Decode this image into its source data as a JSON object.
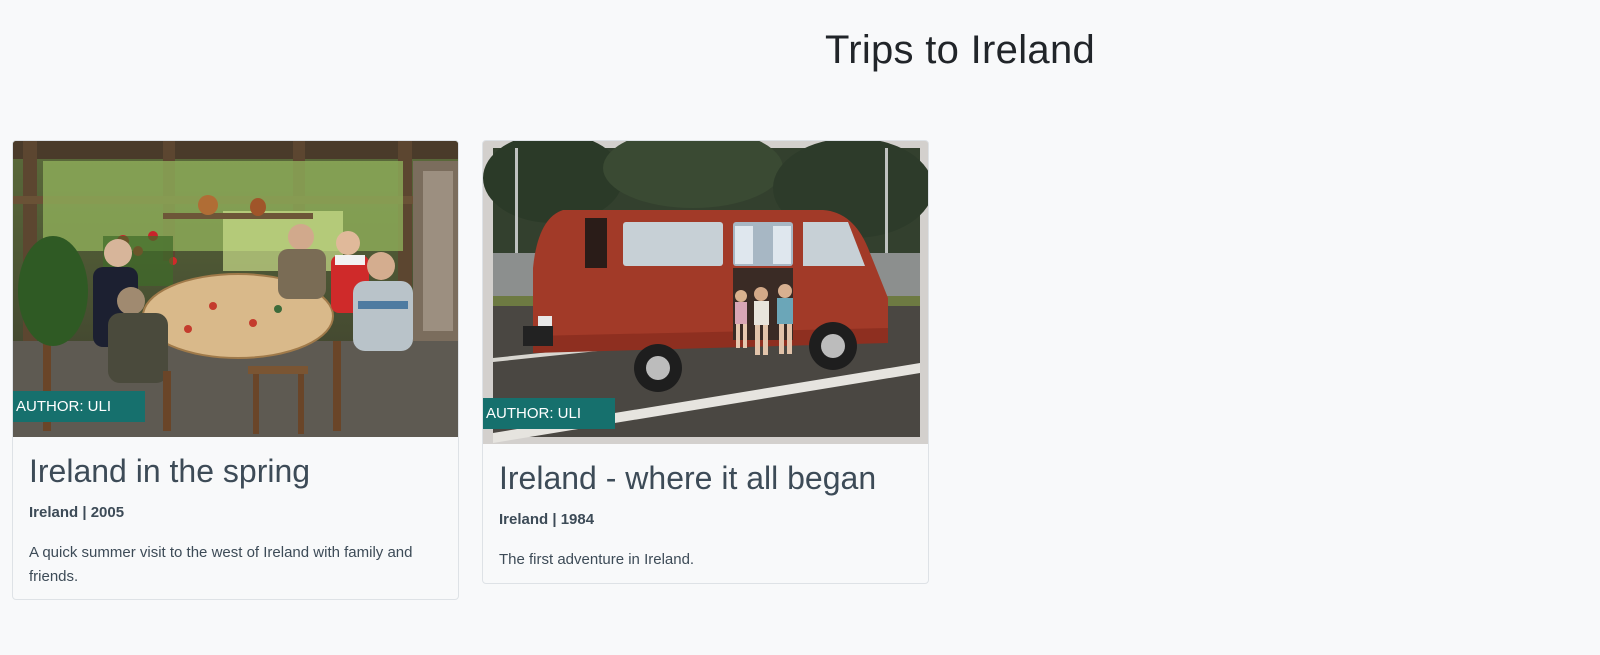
{
  "page": {
    "title": "Trips to Ireland"
  },
  "cards": [
    {
      "author": "AUTHOR: ULI",
      "title": "Ireland in the spring",
      "meta": "Ireland | 2005",
      "description": "A quick summer visit to the west of Ireland with family and friends.",
      "image_subject": "family dinner in a garden conservatory"
    },
    {
      "author": "AUTHOR: ULI",
      "title": "Ireland - where it all began",
      "meta": "Ireland | 1984",
      "description": "The first adventure in Ireland.",
      "image_subject": "red camper van with children"
    }
  ],
  "colors": {
    "badge": "#16706d",
    "background": "#f8f9fa",
    "title_text": "#212529",
    "card_text": "#3d4b57"
  }
}
